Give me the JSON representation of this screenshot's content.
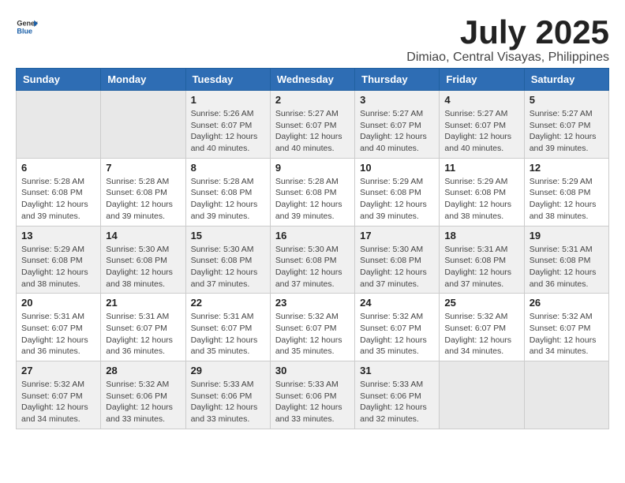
{
  "logo": {
    "general": "General",
    "blue": "Blue"
  },
  "title": "July 2025",
  "subtitle": "Dimiao, Central Visayas, Philippines",
  "days_header": [
    "Sunday",
    "Monday",
    "Tuesday",
    "Wednesday",
    "Thursday",
    "Friday",
    "Saturday"
  ],
  "weeks": [
    [
      {
        "day": "",
        "info": ""
      },
      {
        "day": "",
        "info": ""
      },
      {
        "day": "1",
        "info": "Sunrise: 5:26 AM\nSunset: 6:07 PM\nDaylight: 12 hours\nand 40 minutes."
      },
      {
        "day": "2",
        "info": "Sunrise: 5:27 AM\nSunset: 6:07 PM\nDaylight: 12 hours\nand 40 minutes."
      },
      {
        "day": "3",
        "info": "Sunrise: 5:27 AM\nSunset: 6:07 PM\nDaylight: 12 hours\nand 40 minutes."
      },
      {
        "day": "4",
        "info": "Sunrise: 5:27 AM\nSunset: 6:07 PM\nDaylight: 12 hours\nand 40 minutes."
      },
      {
        "day": "5",
        "info": "Sunrise: 5:27 AM\nSunset: 6:07 PM\nDaylight: 12 hours\nand 39 minutes."
      }
    ],
    [
      {
        "day": "6",
        "info": "Sunrise: 5:28 AM\nSunset: 6:08 PM\nDaylight: 12 hours\nand 39 minutes."
      },
      {
        "day": "7",
        "info": "Sunrise: 5:28 AM\nSunset: 6:08 PM\nDaylight: 12 hours\nand 39 minutes."
      },
      {
        "day": "8",
        "info": "Sunrise: 5:28 AM\nSunset: 6:08 PM\nDaylight: 12 hours\nand 39 minutes."
      },
      {
        "day": "9",
        "info": "Sunrise: 5:28 AM\nSunset: 6:08 PM\nDaylight: 12 hours\nand 39 minutes."
      },
      {
        "day": "10",
        "info": "Sunrise: 5:29 AM\nSunset: 6:08 PM\nDaylight: 12 hours\nand 39 minutes."
      },
      {
        "day": "11",
        "info": "Sunrise: 5:29 AM\nSunset: 6:08 PM\nDaylight: 12 hours\nand 38 minutes."
      },
      {
        "day": "12",
        "info": "Sunrise: 5:29 AM\nSunset: 6:08 PM\nDaylight: 12 hours\nand 38 minutes."
      }
    ],
    [
      {
        "day": "13",
        "info": "Sunrise: 5:29 AM\nSunset: 6:08 PM\nDaylight: 12 hours\nand 38 minutes."
      },
      {
        "day": "14",
        "info": "Sunrise: 5:30 AM\nSunset: 6:08 PM\nDaylight: 12 hours\nand 38 minutes."
      },
      {
        "day": "15",
        "info": "Sunrise: 5:30 AM\nSunset: 6:08 PM\nDaylight: 12 hours\nand 37 minutes."
      },
      {
        "day": "16",
        "info": "Sunrise: 5:30 AM\nSunset: 6:08 PM\nDaylight: 12 hours\nand 37 minutes."
      },
      {
        "day": "17",
        "info": "Sunrise: 5:30 AM\nSunset: 6:08 PM\nDaylight: 12 hours\nand 37 minutes."
      },
      {
        "day": "18",
        "info": "Sunrise: 5:31 AM\nSunset: 6:08 PM\nDaylight: 12 hours\nand 37 minutes."
      },
      {
        "day": "19",
        "info": "Sunrise: 5:31 AM\nSunset: 6:08 PM\nDaylight: 12 hours\nand 36 minutes."
      }
    ],
    [
      {
        "day": "20",
        "info": "Sunrise: 5:31 AM\nSunset: 6:07 PM\nDaylight: 12 hours\nand 36 minutes."
      },
      {
        "day": "21",
        "info": "Sunrise: 5:31 AM\nSunset: 6:07 PM\nDaylight: 12 hours\nand 36 minutes."
      },
      {
        "day": "22",
        "info": "Sunrise: 5:31 AM\nSunset: 6:07 PM\nDaylight: 12 hours\nand 35 minutes."
      },
      {
        "day": "23",
        "info": "Sunrise: 5:32 AM\nSunset: 6:07 PM\nDaylight: 12 hours\nand 35 minutes."
      },
      {
        "day": "24",
        "info": "Sunrise: 5:32 AM\nSunset: 6:07 PM\nDaylight: 12 hours\nand 35 minutes."
      },
      {
        "day": "25",
        "info": "Sunrise: 5:32 AM\nSunset: 6:07 PM\nDaylight: 12 hours\nand 34 minutes."
      },
      {
        "day": "26",
        "info": "Sunrise: 5:32 AM\nSunset: 6:07 PM\nDaylight: 12 hours\nand 34 minutes."
      }
    ],
    [
      {
        "day": "27",
        "info": "Sunrise: 5:32 AM\nSunset: 6:07 PM\nDaylight: 12 hours\nand 34 minutes."
      },
      {
        "day": "28",
        "info": "Sunrise: 5:32 AM\nSunset: 6:06 PM\nDaylight: 12 hours\nand 33 minutes."
      },
      {
        "day": "29",
        "info": "Sunrise: 5:33 AM\nSunset: 6:06 PM\nDaylight: 12 hours\nand 33 minutes."
      },
      {
        "day": "30",
        "info": "Sunrise: 5:33 AM\nSunset: 6:06 PM\nDaylight: 12 hours\nand 33 minutes."
      },
      {
        "day": "31",
        "info": "Sunrise: 5:33 AM\nSunset: 6:06 PM\nDaylight: 12 hours\nand 32 minutes."
      },
      {
        "day": "",
        "info": ""
      },
      {
        "day": "",
        "info": ""
      }
    ]
  ]
}
